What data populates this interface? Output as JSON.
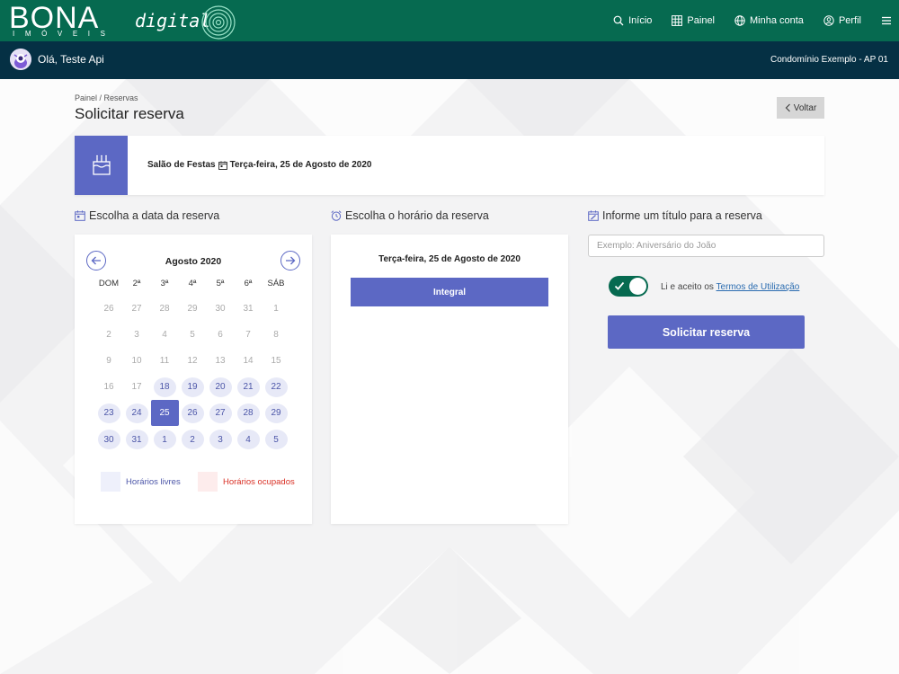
{
  "header": {
    "logo_text": "BONA",
    "logo_subtext": "IMÓVEIS",
    "logo_digital": "digital",
    "nav": [
      {
        "label": "Início",
        "icon": "search-icon"
      },
      {
        "label": "Painel",
        "icon": "grid-icon"
      },
      {
        "label": "Minha conta",
        "icon": "globe-icon"
      },
      {
        "label": "Perfil",
        "icon": "user-icon"
      }
    ],
    "menu_icon": "hamburger-icon",
    "color": "#066a50"
  },
  "userbar": {
    "greeting": "Olá, Teste Api",
    "condominium": "Condomínio Exemplo - AP 01",
    "color": "#053044"
  },
  "page": {
    "breadcrumb": "Painel  /  Reservas",
    "title": "Solicitar reserva",
    "back_label": "Voltar"
  },
  "summary": {
    "area": "Salão de Festas",
    "date": "Terça-feira, 25 de Agosto de 2020",
    "icon": "cake-icon",
    "accent": "#5c68c4"
  },
  "calendar": {
    "heading": "Escolha a data da reserva",
    "month": "Agosto 2020",
    "weekdays": [
      "DOM",
      "2ª",
      "3ª",
      "4ª",
      "5ª",
      "6ª",
      "SÁB"
    ],
    "weeks": [
      [
        {
          "d": "26",
          "s": "disabled"
        },
        {
          "d": "27",
          "s": "disabled"
        },
        {
          "d": "28",
          "s": "disabled"
        },
        {
          "d": "29",
          "s": "disabled"
        },
        {
          "d": "30",
          "s": "disabled"
        },
        {
          "d": "31",
          "s": "disabled"
        },
        {
          "d": "1",
          "s": "disabled"
        }
      ],
      [
        {
          "d": "2",
          "s": "disabled"
        },
        {
          "d": "3",
          "s": "disabled"
        },
        {
          "d": "4",
          "s": "disabled"
        },
        {
          "d": "5",
          "s": "disabled"
        },
        {
          "d": "6",
          "s": "disabled"
        },
        {
          "d": "7",
          "s": "disabled"
        },
        {
          "d": "8",
          "s": "disabled"
        }
      ],
      [
        {
          "d": "9",
          "s": "disabled"
        },
        {
          "d": "10",
          "s": "disabled"
        },
        {
          "d": "11",
          "s": "disabled"
        },
        {
          "d": "12",
          "s": "disabled"
        },
        {
          "d": "13",
          "s": "disabled"
        },
        {
          "d": "14",
          "s": "disabled"
        },
        {
          "d": "15",
          "s": "disabled"
        }
      ],
      [
        {
          "d": "16",
          "s": "disabled"
        },
        {
          "d": "17",
          "s": "disabled"
        },
        {
          "d": "18",
          "s": "free"
        },
        {
          "d": "19",
          "s": "free"
        },
        {
          "d": "20",
          "s": "free"
        },
        {
          "d": "21",
          "s": "free"
        },
        {
          "d": "22",
          "s": "free"
        }
      ],
      [
        {
          "d": "23",
          "s": "free"
        },
        {
          "d": "24",
          "s": "free"
        },
        {
          "d": "25",
          "s": "selected"
        },
        {
          "d": "26",
          "s": "free"
        },
        {
          "d": "27",
          "s": "free"
        },
        {
          "d": "28",
          "s": "free"
        },
        {
          "d": "29",
          "s": "free"
        }
      ],
      [
        {
          "d": "30",
          "s": "free"
        },
        {
          "d": "31",
          "s": "free"
        },
        {
          "d": "1",
          "s": "free"
        },
        {
          "d": "2",
          "s": "free"
        },
        {
          "d": "3",
          "s": "free"
        },
        {
          "d": "4",
          "s": "free"
        },
        {
          "d": "5",
          "s": "free"
        }
      ]
    ],
    "legend_free": "Horários livres",
    "legend_busy": "Horários ocupados",
    "free_color": "#4c56a8",
    "busy_color": "#d93025"
  },
  "time": {
    "heading": "Escolha o horário da reserva",
    "date": "Terça-feira, 25 de Agosto de 2020",
    "slot": "Integral"
  },
  "form": {
    "heading": "Informe um título para a reserva",
    "placeholder": "Exemplo: Aniversário do João",
    "terms_prefix": "Li e aceito os",
    "terms_link": "Termos de Utilização",
    "terms_accepted": true,
    "submit": "Solicitar reserva"
  }
}
